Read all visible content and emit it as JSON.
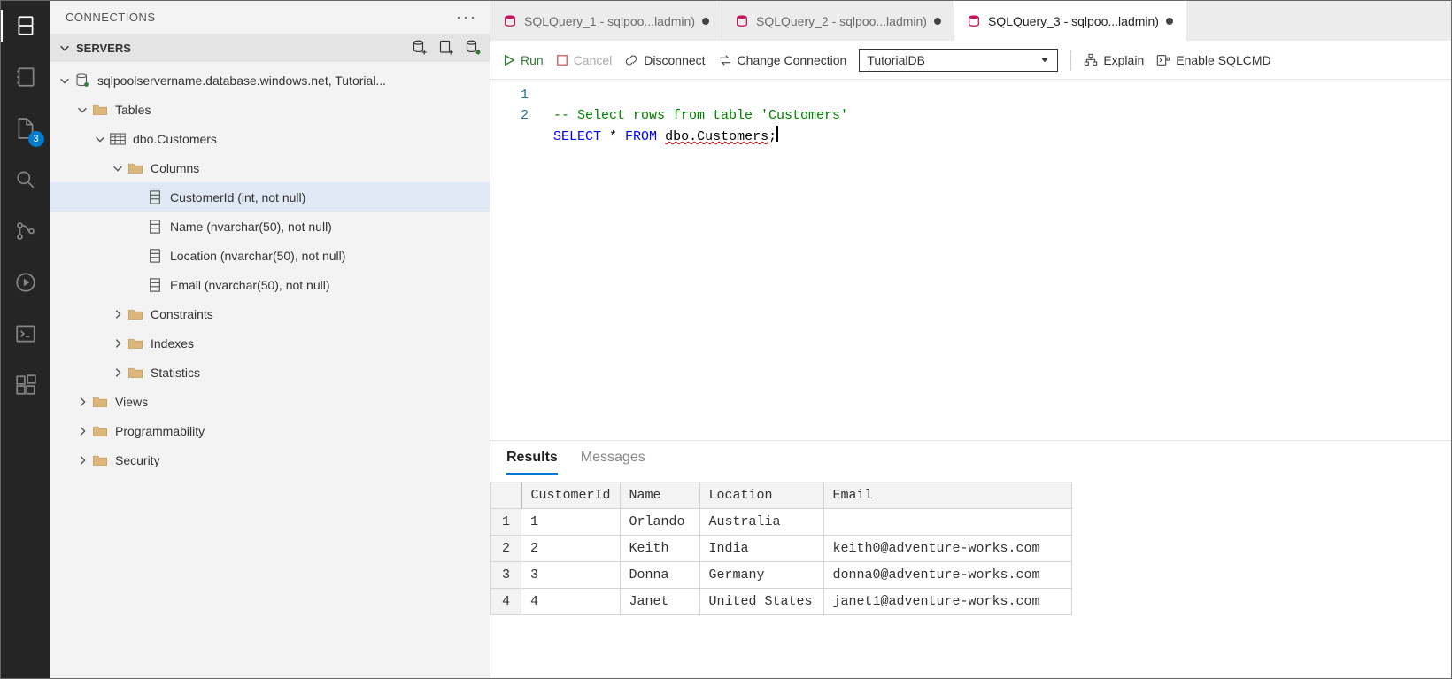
{
  "sidebar": {
    "title": "CONNECTIONS",
    "section": "SERVERS",
    "tree": {
      "server": "sqlpoolservername.database.windows.net, Tutorial...",
      "tables": "Tables",
      "table_dbo": "dbo.Customers",
      "columns": "Columns",
      "col0": "CustomerId (int, not null)",
      "col1": "Name (nvarchar(50), not null)",
      "col2": "Location (nvarchar(50), not null)",
      "col3": "Email (nvarchar(50), not null)",
      "constraints": "Constraints",
      "indexes": "Indexes",
      "statistics": "Statistics",
      "views": "Views",
      "programmability": "Programmability",
      "security": "Security"
    }
  },
  "activity": {
    "files_badge": "3"
  },
  "tabs": {
    "t0": "SQLQuery_1 - sqlpoo...ladmin)",
    "t1": "SQLQuery_2 - sqlpoo...ladmin)",
    "t2": "SQLQuery_3 - sqlpoo...ladmin)"
  },
  "toolbar": {
    "run": "Run",
    "cancel": "Cancel",
    "disconnect": "Disconnect",
    "change_conn": "Change Connection",
    "db_selected": "TutorialDB",
    "explain": "Explain",
    "enable_sqlcmd": "Enable SQLCMD"
  },
  "editor": {
    "line1_num": "1",
    "line2_num": "2",
    "line1_comment": "-- Select rows from table 'Customers'",
    "line2_kw1": "SELECT",
    "line2_star": " * ",
    "line2_kw2": "FROM",
    "line2_space": " ",
    "line2_obj": "dbo.Customers",
    "line2_semi": ";"
  },
  "results": {
    "tab_results": "Results",
    "tab_messages": "Messages",
    "headers": {
      "h0": "CustomerId",
      "h1": "Name",
      "h2": "Location",
      "h3": "Email"
    },
    "rows": {
      "r0": {
        "n": "1",
        "c0": "1",
        "c1": "Orlando",
        "c2": "Australia",
        "c3": ""
      },
      "r1": {
        "n": "2",
        "c0": "2",
        "c1": "Keith",
        "c2": "India",
        "c3": "keith0@adventure-works.com"
      },
      "r2": {
        "n": "3",
        "c0": "3",
        "c1": "Donna",
        "c2": "Germany",
        "c3": "donna0@adventure-works.com"
      },
      "r3": {
        "n": "4",
        "c0": "4",
        "c1": "Janet",
        "c2": "United States",
        "c3": "janet1@adventure-works.com"
      }
    }
  }
}
